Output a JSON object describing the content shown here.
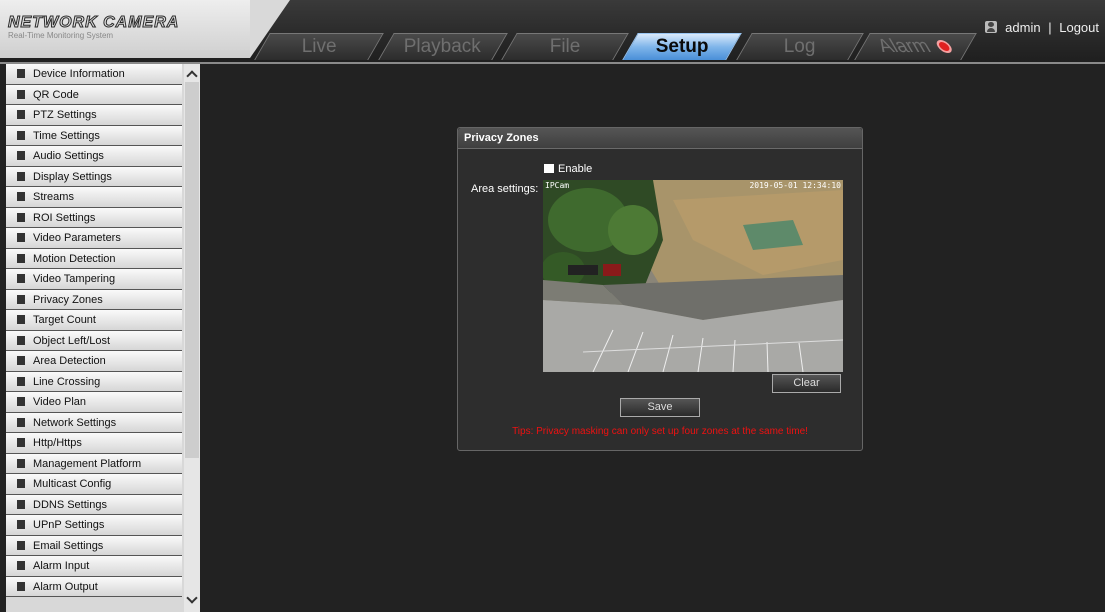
{
  "header": {
    "brand": "NETWORK CAMERA",
    "tagline": "Real-Time Monitoring System",
    "tabs": [
      {
        "label": "Live"
      },
      {
        "label": "Playback"
      },
      {
        "label": "File"
      },
      {
        "label": "Setup",
        "active": true
      },
      {
        "label": "Log"
      },
      {
        "label": "Alarm"
      }
    ],
    "user": "admin",
    "separator": "|",
    "logout": "Logout"
  },
  "sidebar": {
    "items": [
      "Device Information",
      "QR Code",
      "PTZ Settings",
      "Time Settings",
      "Audio Settings",
      "Display Settings",
      "Streams",
      "ROI Settings",
      "Video Parameters",
      "Motion Detection",
      "Video Tampering",
      "Privacy Zones",
      "Target Count",
      "Object Left/Lost",
      "Area Detection",
      "Line Crossing",
      "Video Plan",
      "Network Settings",
      "Http/Https",
      "Management Platform",
      "Multicast Config",
      "DDNS Settings",
      "UPnP Settings",
      "Email Settings",
      "Alarm Input",
      "Alarm Output"
    ]
  },
  "panel": {
    "title": "Privacy Zones",
    "enable_label": "Enable",
    "enable_checked": false,
    "area_label": "Area settings:",
    "osd_name": "IPCam",
    "osd_date": "2019-05-01 12:34:10",
    "clear_label": "Clear",
    "save_label": "Save",
    "tips": "Tips: Privacy masking can only set up four zones at the same time!"
  },
  "colors": {
    "active_tab": "#4a8fd8",
    "tips_text": "#e11111",
    "alarm_indicator": "#e02020"
  }
}
